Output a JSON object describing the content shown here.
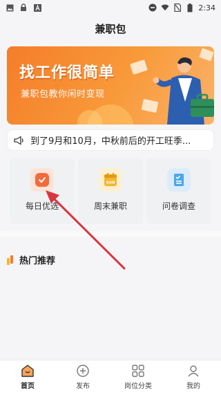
{
  "status_bar": {
    "time": "2:34",
    "left_icons": [
      "image-icon",
      "lock-icon",
      "font-icon"
    ],
    "right_icons": [
      "do-not-disturb-icon",
      "wifi-icon",
      "no-sim-icon",
      "battery-icon"
    ]
  },
  "header": {
    "title": "兼职包"
  },
  "banner": {
    "title": "找工作很简单",
    "subtitle": "兼职包教你闲时变现"
  },
  "notice": {
    "icon": "megaphone-icon",
    "text": "到了9月和10月，中秋前后的开工旺季..."
  },
  "categories": [
    {
      "label": "每日优选",
      "icon": "clock-icon",
      "color": "#f26b3a"
    },
    {
      "label": "周末兼职",
      "icon": "calendar-icon",
      "color": "#f5b52e"
    },
    {
      "label": "问卷调查",
      "icon": "clipboard-icon",
      "color": "#4aa8e8"
    }
  ],
  "section": {
    "title": "热门推荐"
  },
  "bottom_nav": [
    {
      "label": "首页",
      "icon": "home-icon",
      "active": true
    },
    {
      "label": "发布",
      "icon": "plus-circle-icon",
      "active": false
    },
    {
      "label": "岗位分类",
      "icon": "grid-icon",
      "active": false
    },
    {
      "label": "我的",
      "icon": "profile-icon",
      "active": false
    }
  ],
  "colors": {
    "accent": "#f57d2a",
    "annotation_arrow": "#d9363e"
  }
}
